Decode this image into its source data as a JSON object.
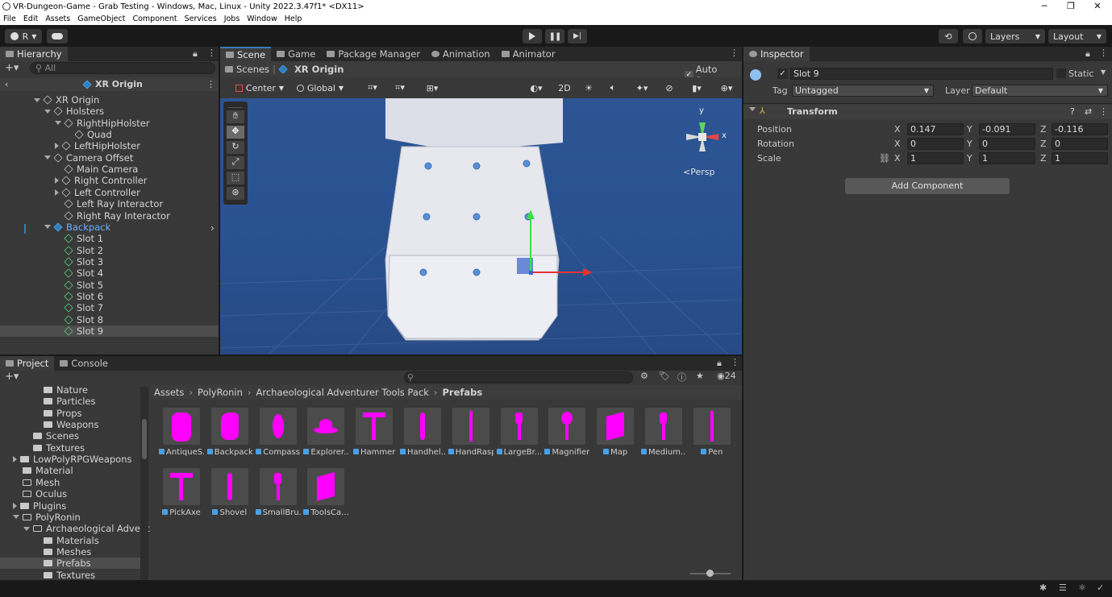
{
  "window": {
    "title": "VR-Dungeon-Game - Grab Testing - Windows, Mac, Linux - Unity 2022.3.47f1* <DX11>"
  },
  "menu": [
    "File",
    "Edit",
    "Assets",
    "GameObject",
    "Component",
    "Services",
    "Jobs",
    "Window",
    "Help"
  ],
  "toolbar": {
    "account": "R",
    "layers": "Layers",
    "layout": "Layout"
  },
  "hierarchy": {
    "tab": "Hierarchy",
    "search_placeholder": "All",
    "root": "XR Origin",
    "items": [
      {
        "label": "XR Origin",
        "depth": 0,
        "expand": "down",
        "icon": "cube"
      },
      {
        "label": "Holsters",
        "depth": 1,
        "expand": "down",
        "icon": "cube"
      },
      {
        "label": "RightHipHolster",
        "depth": 2,
        "expand": "down",
        "icon": "cube"
      },
      {
        "label": "Quad",
        "depth": 3,
        "expand": "",
        "icon": "cube"
      },
      {
        "label": "LeftHipHolster",
        "depth": 2,
        "expand": "right",
        "icon": "cube"
      },
      {
        "label": "Camera Offset",
        "depth": 1,
        "expand": "down",
        "icon": "cube"
      },
      {
        "label": "Main Camera",
        "depth": 2,
        "expand": "",
        "icon": "cube"
      },
      {
        "label": "Right Controller",
        "depth": 2,
        "expand": "right",
        "icon": "cube"
      },
      {
        "label": "Left Controller",
        "depth": 2,
        "expand": "right",
        "icon": "cube"
      },
      {
        "label": "Left Ray Interactor",
        "depth": 2,
        "expand": "",
        "icon": "cube"
      },
      {
        "label": "Right Ray Interactor",
        "depth": 2,
        "expand": "",
        "icon": "cube"
      },
      {
        "label": "Backpack",
        "depth": 1,
        "expand": "down",
        "icon": "blue"
      },
      {
        "label": "Slot 1",
        "depth": 2,
        "expand": "",
        "icon": "green"
      },
      {
        "label": "Slot 2",
        "depth": 2,
        "expand": "",
        "icon": "green"
      },
      {
        "label": "Slot 3",
        "depth": 2,
        "expand": "",
        "icon": "green"
      },
      {
        "label": "Slot 4",
        "depth": 2,
        "expand": "",
        "icon": "green"
      },
      {
        "label": "Slot 5",
        "depth": 2,
        "expand": "",
        "icon": "green"
      },
      {
        "label": "Slot 6",
        "depth": 2,
        "expand": "",
        "icon": "green"
      },
      {
        "label": "Slot 7",
        "depth": 2,
        "expand": "",
        "icon": "green"
      },
      {
        "label": "Slot 8",
        "depth": 2,
        "expand": "",
        "icon": "green"
      },
      {
        "label": "Slot 9",
        "depth": 2,
        "expand": "",
        "icon": "green",
        "selected": true
      }
    ]
  },
  "scene": {
    "tabs": [
      "Scene",
      "Game",
      "Package Manager",
      "Animation",
      "Animator"
    ],
    "breadcrumb": [
      "Scenes",
      "XR Origin"
    ],
    "auto_save": "Auto Save",
    "pivot": "Center",
    "space": "Global",
    "mode_2d": "2D",
    "persp": "<Persp",
    "axis_y": "y",
    "axis_x": "x"
  },
  "inspector": {
    "tab": "Inspector",
    "object_name": "Slot 9",
    "static": "Static",
    "tag_label": "Tag",
    "tag_value": "Untagged",
    "layer_label": "Layer",
    "layer_value": "Default",
    "component": "Transform",
    "rows": [
      {
        "label": "Position",
        "x": "0.147",
        "y": "-0.091",
        "z": "-0.116"
      },
      {
        "label": "Rotation",
        "x": "0",
        "y": "0",
        "z": "0"
      },
      {
        "label": "Scale",
        "x": "1",
        "y": "1",
        "z": "1"
      }
    ],
    "axis_x": "X",
    "axis_y": "Y",
    "axis_z": "Z",
    "add_component": "Add Component"
  },
  "project": {
    "tabs": [
      "Project",
      "Console"
    ],
    "count": "24",
    "breadcrumb": [
      "Assets",
      "PolyRonin",
      "Archaeological Adventurer Tools Pack",
      "Prefabs"
    ],
    "folders": [
      {
        "label": "Nature",
        "depth": 2,
        "expand": ""
      },
      {
        "label": "Particles",
        "depth": 2,
        "expand": ""
      },
      {
        "label": "Props",
        "depth": 2,
        "expand": ""
      },
      {
        "label": "Weapons",
        "depth": 2,
        "expand": ""
      },
      {
        "label": "Scenes",
        "depth": 1,
        "expand": ""
      },
      {
        "label": "Textures",
        "depth": 1,
        "expand": ""
      },
      {
        "label": "LowPolyRPGWeapons",
        "depth": 0,
        "expand": "right"
      },
      {
        "label": "Material",
        "depth": 0,
        "expand": ""
      },
      {
        "label": "Mesh",
        "depth": 0,
        "expand": "",
        "open": true
      },
      {
        "label": "Oculus",
        "depth": 0,
        "expand": "",
        "open": true
      },
      {
        "label": "Plugins",
        "depth": 0,
        "expand": "right"
      },
      {
        "label": "PolyRonin",
        "depth": 0,
        "expand": "down",
        "open": true
      },
      {
        "label": "Archaeological Advent",
        "depth": 1,
        "expand": "down",
        "open": true
      },
      {
        "label": "Materials",
        "depth": 2,
        "expand": ""
      },
      {
        "label": "Meshes",
        "depth": 2,
        "expand": ""
      },
      {
        "label": "Prefabs",
        "depth": 2,
        "expand": "",
        "selected": true
      },
      {
        "label": "Textures",
        "depth": 2,
        "expand": ""
      }
    ],
    "assets": [
      {
        "label": "AntiqueS...",
        "shape": "blob"
      },
      {
        "label": "Backpack",
        "shape": "bag"
      },
      {
        "label": "Compass",
        "shape": "drop"
      },
      {
        "label": "Explorer...",
        "shape": "hat"
      },
      {
        "label": "Hammer",
        "shape": "hammer"
      },
      {
        "label": "Handhel...",
        "shape": "thin"
      },
      {
        "label": "HandRasp",
        "shape": "stick"
      },
      {
        "label": "LargeBr...",
        "shape": "brush"
      },
      {
        "label": "Magnifier",
        "shape": "mag"
      },
      {
        "label": "Map",
        "shape": "map"
      },
      {
        "label": "Medium...",
        "shape": "brush"
      },
      {
        "label": "Pen",
        "shape": "stick"
      },
      {
        "label": "PickAxe",
        "shape": "hammer"
      },
      {
        "label": "Shovel",
        "shape": "thin"
      },
      {
        "label": "SmallBru...",
        "shape": "brush"
      },
      {
        "label": "ToolsCa...",
        "shape": "map"
      }
    ]
  },
  "colors": {
    "accent": "#3a79bb",
    "magenta": "#ff00ff",
    "sky": "#2c4f86",
    "ground": "#2a4b85"
  }
}
